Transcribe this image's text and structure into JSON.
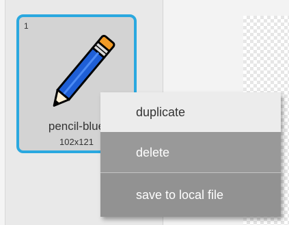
{
  "costume": {
    "number": "1",
    "name": "pencil-blue",
    "size": "102x121",
    "icon": "pencil-icon",
    "selected_border_color": "#2aa8df"
  },
  "context_menu": {
    "items": [
      {
        "label": "duplicate",
        "highlighted": true
      },
      {
        "label": "delete"
      },
      {
        "label": "save to local file"
      }
    ],
    "background_color": "#929292",
    "highlight_color": "#ececec"
  }
}
